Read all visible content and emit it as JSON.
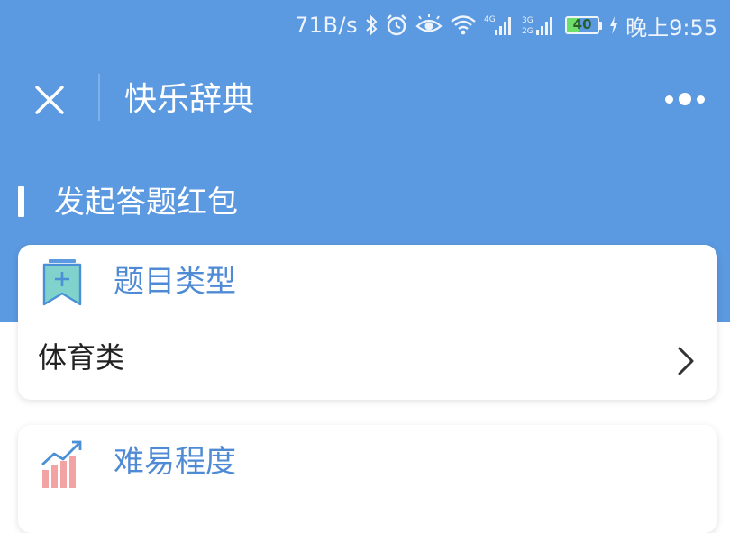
{
  "status_bar": {
    "net_speed": "71B/s",
    "icons": [
      "bluetooth-icon",
      "alarm-icon",
      "eye-icon",
      "wifi-icon",
      "signal-4g-icon",
      "signal-3g-icon"
    ],
    "battery_level": "40",
    "battery_fraction": 0.4,
    "charging_icon": "charging-bolt-icon",
    "time": "晚上9:55"
  },
  "nav": {
    "close_icon": "close-icon",
    "title": "快乐辞典",
    "more_icon": "more-dots-icon"
  },
  "section": {
    "title": "发起答题红包"
  },
  "cards": {
    "type": {
      "icon": "bookmark-plus-icon",
      "title": "题目类型",
      "value": "体育类",
      "chevron": "chevron-right-icon"
    },
    "difficulty": {
      "icon": "bar-chart-trend-icon",
      "title": "难易程度"
    }
  },
  "colors": {
    "header": "#5b99e1",
    "accent_text": "#4f8ad5",
    "card_bg": "#ffffff",
    "icon_teal": "#5ec6c0",
    "icon_pink": "#f3a3a3"
  }
}
